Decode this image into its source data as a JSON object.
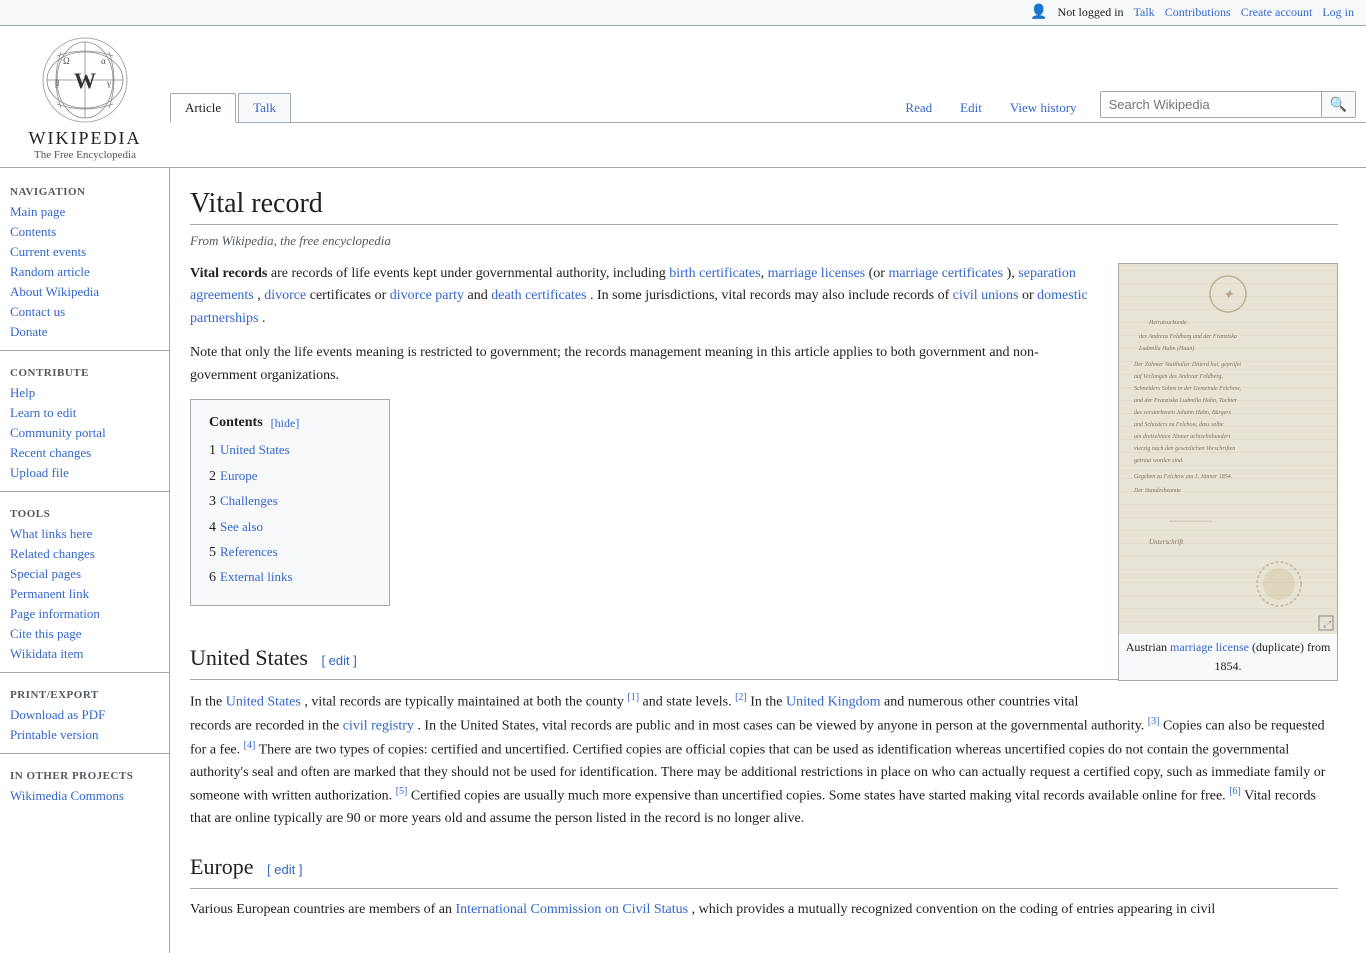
{
  "topbar": {
    "not_logged_in": "Not logged in",
    "talk": "Talk",
    "contributions": "Contributions",
    "create_account": "Create account",
    "log_in": "Log in"
  },
  "logo": {
    "title": "Wikipedia",
    "subtitle": "The Free Encyclopedia"
  },
  "tabs": {
    "article": "Article",
    "talk": "Talk",
    "read": "Read",
    "edit": "Edit",
    "view_history": "View history"
  },
  "search": {
    "placeholder": "Search Wikipedia"
  },
  "sidebar": {
    "navigation_title": "Navigation",
    "main_page": "Main page",
    "contents": "Contents",
    "current_events": "Current events",
    "random_article": "Random article",
    "about_wikipedia": "About Wikipedia",
    "contact_us": "Contact us",
    "donate": "Donate",
    "contribute_title": "Contribute",
    "help": "Help",
    "learn_to_edit": "Learn to edit",
    "community_portal": "Community portal",
    "recent_changes": "Recent changes",
    "upload_file": "Upload file",
    "tools_title": "Tools",
    "what_links_here": "What links here",
    "related_changes": "Related changes",
    "special_pages": "Special pages",
    "permanent_link": "Permanent link",
    "page_information": "Page information",
    "cite_this_page": "Cite this page",
    "wikidata_item": "Wikidata item",
    "print_title": "Print/export",
    "download_pdf": "Download as PDF",
    "printable_version": "Printable version",
    "other_projects_title": "In other projects",
    "wikimedia_commons": "Wikimedia Commons"
  },
  "article": {
    "title": "Vital record",
    "subtitle": "From Wikipedia, the free encyclopedia",
    "intro_bold": "Vital records",
    "intro": " are records of life events kept under governmental authority, including ",
    "link_birth_certificates": "birth certificates",
    "link_marriage_licenses": "marriage licenses",
    "intro2": " (or ",
    "link_marriage_certificates": "marriage certificates",
    "intro3": "), ",
    "link_separation_agreements": "separation agreements",
    "intro4": ", ",
    "link_divorce": "divorce",
    "intro5": " certificates or ",
    "link_divorce_party": "divorce party",
    "intro6": " and ",
    "link_death_certificates": "death certificates",
    "intro7": ". In some jurisdictions, vital records may also include records of ",
    "link_civil_unions": "civil unions",
    "intro8": " or ",
    "link_domestic_partnerships": "domestic partnerships",
    "intro9": ".",
    "note": "Note that only the life events meaning is restricted to government; the records management meaning in this article applies to both government and non-government organizations.",
    "contents_header": "Contents",
    "contents_hide": "[hide]",
    "contents_items": [
      {
        "num": "1",
        "label": "United States"
      },
      {
        "num": "2",
        "label": "Europe"
      },
      {
        "num": "3",
        "label": "Challenges"
      },
      {
        "num": "4",
        "label": "See also"
      },
      {
        "num": "5",
        "label": "References"
      },
      {
        "num": "6",
        "label": "External links"
      }
    ],
    "us_section_title": "United States",
    "us_edit": "[ edit ]",
    "us_para1_pre": "In the ",
    "us_link_us": "United States",
    "us_para1_post": ", vital records are typically maintained at both the county",
    "us_ref1": "[1]",
    "us_para1_post2": " and state levels.",
    "us_ref2": "[2]",
    "us_para1_post3": " In the ",
    "us_link_uk": "United Kingdom",
    "us_para1_post4": " and numerous other countries vital records are recorded in the ",
    "us_link_civil_registry": "civil registry",
    "us_para1_post5": ". In the United States, vital records are public and in most cases can be viewed by anyone in person at the governmental authority.",
    "us_ref3": "[3]",
    "us_para1_post6": " Copies can also be requested for a fee.",
    "us_ref4": "[4]",
    "us_para1_post7": " There are two types of copies: certified and uncertified. Certified copies are official copies that can be used as identification whereas uncertified copies do not contain the governmental authority's seal and often are marked that they should not be used for identification. There may be additional restrictions in place on who can actually request a certified copy, such as immediate family or someone with written authorization.",
    "us_ref5": "[5]",
    "us_para1_post8": " Certified copies are usually much more expensive than uncertified copies. Some states have started making vital records available online for free.",
    "us_ref6": "[6]",
    "us_para1_post9": " Vital records that are online typically are 90 or more years old and assume the person listed in the record is no longer alive.",
    "europe_section_title": "Europe",
    "europe_edit": "[ edit ]",
    "europe_para1": "Various European countries are members of an ",
    "europe_link": "International Commission on Civil Status",
    "europe_para1_post": ", which provides a mutually recognized convention on the coding of entries appearing in civil",
    "image_caption": "Austrian marriage license (duplicate) from 1854.",
    "doc_text_lines": [
      "Heiratsurkunde",
      "des Andreas Feldberg und der Franziska Ludmilla Hahn (Haun)",
      "Der Zahmer Statthalter Ditterd hat, geprüfet auf Verlangen",
      "des Andrear Feldberg, Schneiders Sohns..."
    ]
  }
}
